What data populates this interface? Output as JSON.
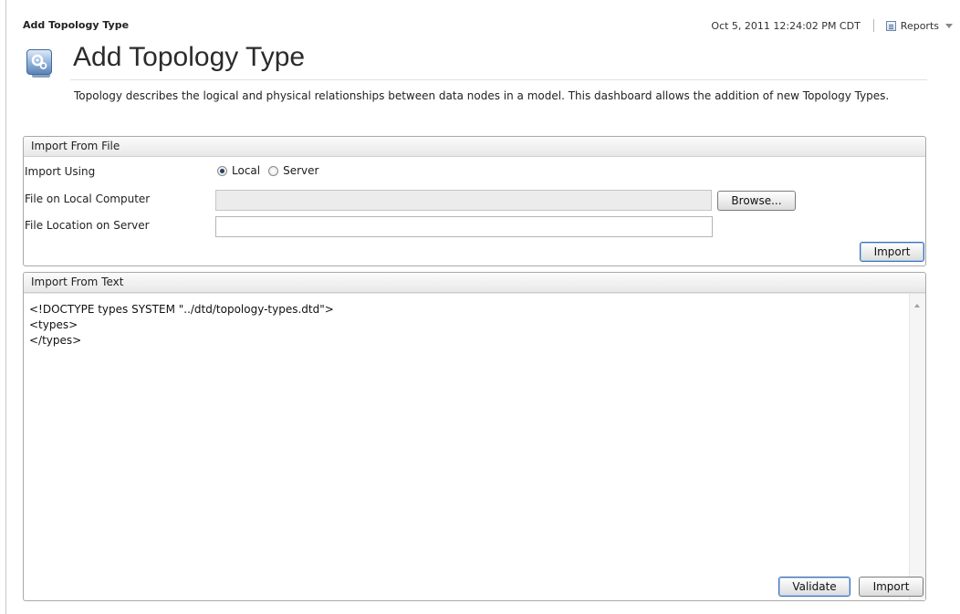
{
  "header": {
    "breadcrumb": "Add Topology Type",
    "timestamp": "Oct 5, 2011 12:24:02 PM CDT",
    "reports_label": "Reports"
  },
  "page": {
    "title": "Add Topology Type",
    "icon": "gears-icon",
    "description": "Topology describes the logical and physical relationships between data nodes in a model. This dashboard allows the addition of new Topology Types."
  },
  "import_file": {
    "header": "Import From File",
    "import_using_label": "Import Using",
    "radio_local": "Local",
    "radio_server": "Server",
    "selected_option": "Local",
    "local_file_label": "File on Local Computer",
    "local_file_value": "",
    "browse_label": "Browse...",
    "server_location_label": "File Location on Server",
    "server_location_value": "",
    "import_button": "Import"
  },
  "import_text": {
    "header": "Import From Text",
    "content": "<!DOCTYPE types SYSTEM \"../dtd/topology-types.dtd\">\n<types>\n</types>",
    "validate_button": "Validate",
    "import_button": "Import"
  }
}
